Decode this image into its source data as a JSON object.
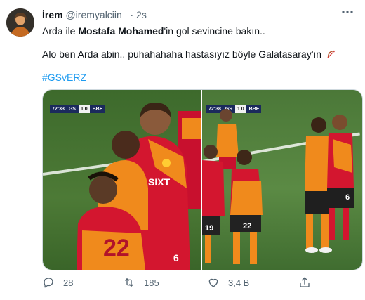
{
  "tweet": {
    "display_name": "İrem",
    "handle": "@iremyalciin_",
    "separator": "·",
    "time": "2s",
    "more_icon": "more-icon",
    "text_line1_part1": "Arda ile ",
    "text_line1_bold": "Mostafa Mohamed",
    "text_line1_part2": "'in gol sevincine bakın..",
    "text_line2": "Alo ben Arda abin.. puhahahaha hastasıyız böyle Galatasaray'ın",
    "text_line2_emoji": "bow-and-arrow-emoji",
    "hashtag": "#GSvERZ"
  },
  "media": {
    "left_scoreboard": {
      "clock": "72:33",
      "home": "GS",
      "score": "1 0",
      "away": "BBE"
    },
    "right_scoreboard": {
      "clock": "72:38",
      "home": "GS",
      "score": "1 0",
      "away": "BBE"
    },
    "jersey_numbers": [
      "22",
      "6",
      "19",
      "22",
      "6"
    ],
    "sponsor": "SIXT"
  },
  "actions": {
    "reply": {
      "icon": "reply-icon",
      "count": "28"
    },
    "retweet": {
      "icon": "retweet-icon",
      "count": "185"
    },
    "like": {
      "icon": "heart-icon",
      "count": "3,4 B"
    },
    "share": {
      "icon": "share-icon",
      "count": ""
    }
  },
  "colors": {
    "link": "#1d9bf0",
    "secondary_text": "#536471",
    "galatasaray_red": "#c8102e",
    "galatasaray_orange": "#f08a1c"
  }
}
